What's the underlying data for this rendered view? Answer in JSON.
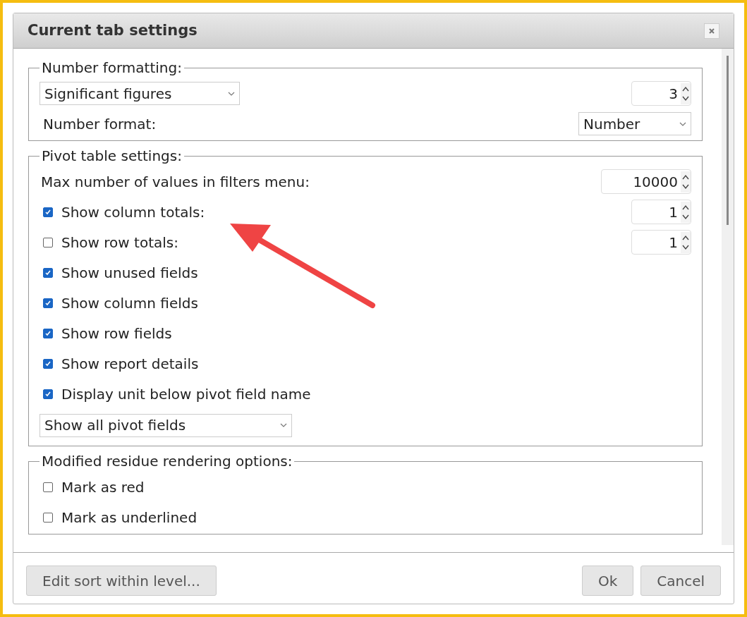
{
  "dialog": {
    "title": "Current tab settings"
  },
  "sections": [
    {
      "legend": "Number formatting:",
      "rows": [
        {
          "kind": "select-spinner",
          "select": "Significant figures",
          "spinner": "3"
        },
        {
          "kind": "label-select",
          "label": "Number format:",
          "select": "Number"
        }
      ]
    },
    {
      "legend": "Pivot table settings:",
      "rows": [
        {
          "kind": "label-spinner",
          "label": "Max number of values in filters menu:",
          "spinner": "10000"
        },
        {
          "kind": "checkbox",
          "label": "Show column totals:",
          "checked": true,
          "spinner": "1"
        },
        {
          "kind": "checkbox",
          "label": "Show row totals:",
          "checked": false,
          "spinner": "1"
        },
        {
          "kind": "checkbox",
          "label": "Show unused fields",
          "checked": true
        },
        {
          "kind": "checkbox",
          "label": "Show column fields",
          "checked": true
        },
        {
          "kind": "checkbox",
          "label": "Show row fields",
          "checked": true
        },
        {
          "kind": "checkbox",
          "label": "Show report details",
          "checked": true
        },
        {
          "kind": "checkbox",
          "label": "Display unit below pivot field name",
          "checked": true
        },
        {
          "kind": "select",
          "select": "Show all pivot fields"
        }
      ]
    },
    {
      "legend": "Modified residue rendering options:",
      "rows": [
        {
          "kind": "checkbox",
          "label": "Mark as red",
          "checked": false
        },
        {
          "kind": "checkbox",
          "label": "Mark as underlined",
          "checked": false
        }
      ]
    }
  ],
  "footer": {
    "left_button": "Edit sort within level...",
    "right_buttons": [
      "Ok",
      "Cancel"
    ]
  }
}
